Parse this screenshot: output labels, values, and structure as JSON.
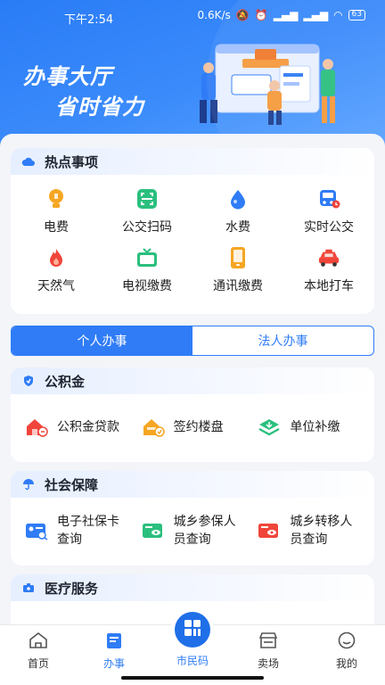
{
  "status_bar": {
    "time": "下午2:54",
    "speed": "0.6K/s",
    "battery": "63"
  },
  "hero": {
    "slogan_line1": "办事大厅",
    "slogan_line2": "省时省力"
  },
  "hot": {
    "title": "热点事项",
    "items": [
      {
        "label": "电费",
        "icon": "bulb-icon",
        "color": "#f5a623"
      },
      {
        "label": "公交扫码",
        "icon": "qr-scan-icon",
        "color": "#2bbf7e"
      },
      {
        "label": "水费",
        "icon": "water-drop-icon",
        "color": "#2f7cf6"
      },
      {
        "label": "实时公交",
        "icon": "bus-icon",
        "color": "#2f7cf6"
      },
      {
        "label": "天然气",
        "icon": "flame-icon",
        "color": "#f0453a"
      },
      {
        "label": "电视缴费",
        "icon": "tv-icon",
        "color": "#2bbf7e"
      },
      {
        "label": "通讯缴费",
        "icon": "phone-icon",
        "color": "#f5a623"
      },
      {
        "label": "本地打车",
        "icon": "car-icon",
        "color": "#f0453a"
      }
    ]
  },
  "tabs": [
    {
      "label": "个人办事",
      "active": true
    },
    {
      "label": "法人办事",
      "active": false
    }
  ],
  "sections": [
    {
      "title": "公积金",
      "items": [
        {
          "label": "公积金贷款",
          "icon": "house-loan-icon",
          "color": "#f0453a"
        },
        {
          "label": "签约楼盘",
          "icon": "building-sign-icon",
          "color": "#f5a623"
        },
        {
          "label": "单位补缴",
          "icon": "layers-icon",
          "color": "#2bbf7e"
        }
      ]
    },
    {
      "title": "社会保障",
      "items": [
        {
          "label": "电子社保卡查询",
          "icon": "id-card-search-icon",
          "color": "#2f7cf6"
        },
        {
          "label": "城乡参保人员查询",
          "icon": "card-view-icon",
          "color": "#2bbf7e"
        },
        {
          "label": "城乡转移人员查询",
          "icon": "card-transfer-icon",
          "color": "#f0453a"
        }
      ]
    },
    {
      "title": "医疗服务",
      "items": []
    }
  ],
  "bottom_nav": [
    {
      "label": "首页",
      "icon": "home-icon",
      "active": false
    },
    {
      "label": "办事",
      "icon": "document-icon",
      "active": true
    },
    {
      "label": "市民码",
      "icon": "app-grid-icon",
      "active": false
    },
    {
      "label": "卖场",
      "icon": "store-icon",
      "active": false
    },
    {
      "label": "我的",
      "icon": "profile-icon",
      "active": false
    }
  ],
  "accent_color": "#2f7cf6"
}
